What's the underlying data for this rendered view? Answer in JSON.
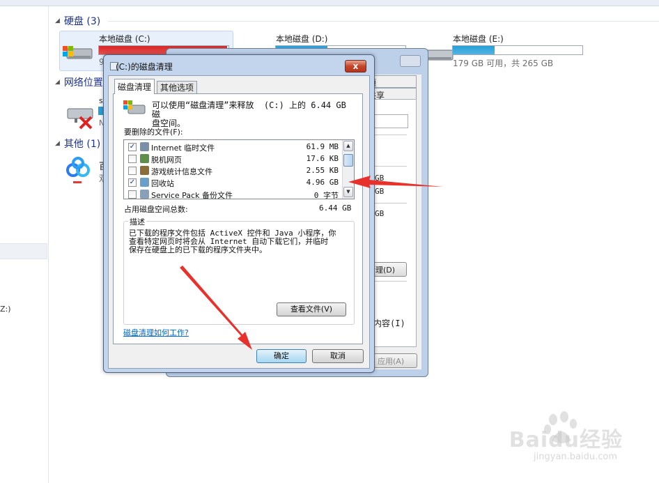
{
  "explorer": {
    "groups": {
      "hdd": "硬盘 (3)",
      "network": "网络位置",
      "other": "其他 (1)"
    },
    "drives": [
      {
        "label": "本地磁盘 (C:)",
        "used_fraction": 0.99,
        "bar_color": "#da2626",
        "info": ""
      },
      {
        "label": "本地磁盘 (D:)",
        "used_fraction": 0.4,
        "bar_color": "#26a0da",
        "info": ""
      },
      {
        "label": "本地磁盘 (E:)",
        "used_fraction": 0.32,
        "bar_color": "#26a0da",
        "info": "179 GB 可用，共 265 GB"
      }
    ],
    "nav_partial": "Z:)",
    "partial_letters": {
      "c_info": "9",
      "net_name": "s",
      "net_info": "N",
      "app_name": "百",
      "app_info": "双"
    }
  },
  "properties_window": {
    "tabs": [
      "额",
      "共享"
    ],
    "values": [
      "GB",
      "GB",
      "GB"
    ],
    "buttons": {
      "cleanup": "清理(D)",
      "apply": "应用(A)"
    },
    "content_label": "内容(I)"
  },
  "dialog": {
    "title": "(C:)的磁盘清理",
    "close_glyph": "x",
    "tabs": [
      "磁盘清理",
      "其他选项"
    ],
    "summary": "可以使用“磁盘清理”来释放  (C:) 上的 6.44 GB 磁\n盘空间。",
    "files_label": "要删除的文件(F):",
    "files": [
      {
        "checked": true,
        "name": "Internet 临时文件",
        "size": "61.9 MB",
        "icon": "ie-file-icon",
        "icon_color": "#7c8fa8"
      },
      {
        "checked": false,
        "name": "脱机网页",
        "size": "17.6 KB",
        "icon": "offline-page-icon",
        "icon_color": "#5e8f4a"
      },
      {
        "checked": false,
        "name": "游戏统计信息文件",
        "size": "2.55 KB",
        "icon": "game-stats-icon",
        "icon_color": "#8a6d3b"
      },
      {
        "checked": true,
        "name": "回收站",
        "size": "4.96 GB",
        "icon": "recycle-bin-icon",
        "icon_color": "#6a9fc9"
      },
      {
        "checked": false,
        "name": "Service Pack 备份文件",
        "size": "0 字节",
        "icon": "service-pack-icon",
        "icon_color": "#8aa0b8"
      }
    ],
    "total_label": "占用磁盘空间总数:",
    "total_value": "6.44 GB",
    "description_legend": "描述",
    "description": "已下载的程序文件包括 ActiveX 控件和 Java 小程序，你\n查看特定网页时将会从 Internet 自动下载它们，并临时\n保存在硬盘上的已下载的程序文件夹中。",
    "view_files_button": "查看文件(V)",
    "help_link": "磁盘清理如何工作?",
    "ok_button": "确定",
    "cancel_button": "取消"
  },
  "annotations": {
    "arrow_color": "#e8312b"
  },
  "watermark": {
    "brand": "Baidu经验",
    "url": "jingyan.baidu.com"
  }
}
